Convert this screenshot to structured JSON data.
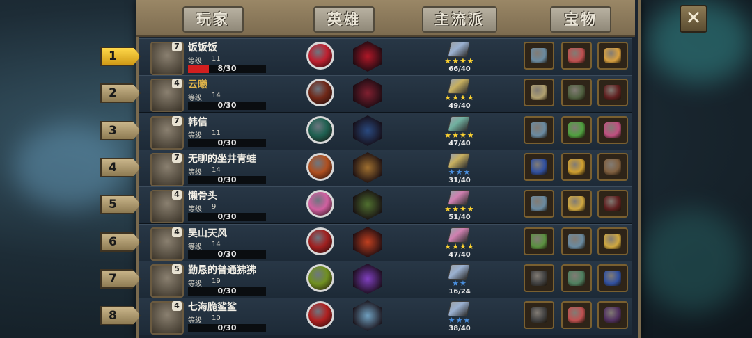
{
  "tabs": [
    {
      "label": "玩家"
    },
    {
      "label": "英雄"
    },
    {
      "label": "主流派"
    },
    {
      "label": "宝物"
    }
  ],
  "close_label": "✕",
  "level_label": "等级",
  "players": [
    {
      "rank": "1",
      "name": "饭饭饭",
      "badge": "7",
      "level": "11",
      "progress": "8/30",
      "progress_fraction": 0.27,
      "stars": "★★★★",
      "stars_color": "#ffd430",
      "count": "66/40",
      "book_color": "#9ab0d0",
      "skill1_color": "#c02030",
      "skill2_color": "#b01828",
      "name_gold": false,
      "items": [
        "#6a8aa0",
        "#c05050",
        "#d8a040"
      ]
    },
    {
      "rank": "2",
      "name": "云曦",
      "badge": "4",
      "level": "14",
      "progress": "0/30",
      "progress_fraction": 0,
      "stars": "★★★★",
      "stars_color": "#ffd430",
      "count": "49/40",
      "book_color": "#c8b060",
      "skill1_color": "#702818",
      "skill2_color": "#802030",
      "name_gold": true,
      "items": [
        "#b0a070",
        "#506040",
        "#602020"
      ]
    },
    {
      "rank": "3",
      "name": "韩信",
      "badge": "7",
      "level": "11",
      "progress": "0/30",
      "progress_fraction": 0,
      "stars": "★★★★",
      "stars_color": "#ffd430",
      "count": "47/40",
      "book_color": "#70b0a0",
      "skill1_color": "#1e6050",
      "skill2_color": "#2a4a80",
      "name_gold": false,
      "items": [
        "#6a8aa0",
        "#50a040",
        "#c05080"
      ]
    },
    {
      "rank": "4",
      "name": "无聊的坐井青蛙",
      "badge": "7",
      "level": "14",
      "progress": "0/30",
      "progress_fraction": 0,
      "stars": "★★★",
      "stars_color": "#4a90e0",
      "count": "31/40",
      "book_color": "#c8b060",
      "skill1_color": "#b05020",
      "skill2_color": "#a07030",
      "name_gold": false,
      "items": [
        "#3050a0",
        "#d0a030",
        "#806040"
      ]
    },
    {
      "rank": "5",
      "name": "懒骨头",
      "badge": "4",
      "level": "9",
      "progress": "0/30",
      "progress_fraction": 0,
      "stars": "★★★★",
      "stars_color": "#ffd430",
      "count": "51/40",
      "book_color": "#d080b0",
      "skill1_color": "#d060a0",
      "skill2_color": "#507030",
      "name_gold": false,
      "items": [
        "#6a8aa0",
        "#d0a840",
        "#602020"
      ]
    },
    {
      "rank": "6",
      "name": "吴山天风",
      "badge": "4",
      "level": "14",
      "progress": "0/30",
      "progress_fraction": 0,
      "stars": "★★★★",
      "stars_color": "#ffd430",
      "count": "47/40",
      "book_color": "#d080b0",
      "skill1_color": "#a02020",
      "skill2_color": "#c04020",
      "name_gold": false,
      "items": [
        "#5a9040",
        "#6a8aa0",
        "#d0a840"
      ]
    },
    {
      "rank": "7",
      "name": "勤恳的普通狒狒",
      "badge": "5",
      "level": "19",
      "progress": "0/30",
      "progress_fraction": 0,
      "stars": "★★",
      "stars_color": "#4a90e0",
      "count": "16/24",
      "book_color": "#9ab0d0",
      "skill1_color": "#709020",
      "skill2_color": "#8040c0",
      "name_gold": false,
      "items": [
        "#404040",
        "#508060",
        "#3050a0"
      ]
    },
    {
      "rank": "8",
      "name": "七海脆鲨鲨",
      "badge": "4",
      "level": "10",
      "progress": "0/30",
      "progress_fraction": 0,
      "stars": "★★★",
      "stars_color": "#4a90e0",
      "count": "38/40",
      "book_color": "#9ab0d0",
      "skill1_color": "#b02020",
      "skill2_color": "#70a0c0",
      "name_gold": false,
      "items": [
        "#404040",
        "#c05050",
        "#503060"
      ]
    }
  ]
}
